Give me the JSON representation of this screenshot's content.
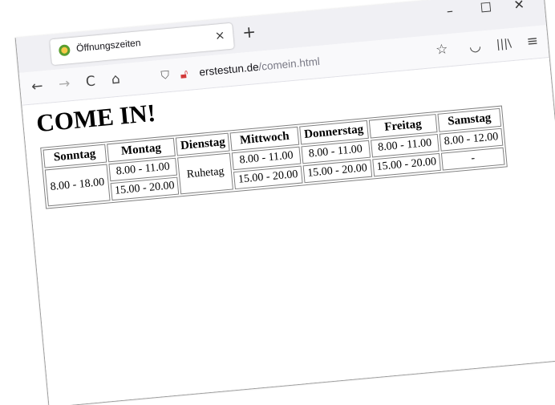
{
  "browser": {
    "tab_title": "Öffnungszeiten",
    "tab_close": "×",
    "new_tab": "+",
    "minimize": "–",
    "maximize": "☐",
    "close": "✕",
    "url_host": "erstestun.de",
    "url_path": "/comein.html",
    "nav": {
      "back": "←",
      "forward": "→",
      "reload": "C",
      "home": "⌂"
    },
    "toolbar": {
      "bookmark": "☆",
      "pocket": "◡",
      "library": "|||\\",
      "menu": "≡"
    },
    "icons": {
      "favicon": "favicon-icon",
      "shield": "shield-icon",
      "lock": "insecure-lock-icon"
    }
  },
  "page": {
    "heading": "COME IN!",
    "days": [
      "Sonntag",
      "Montag",
      "Dienstag",
      "Mittwoch",
      "Donnerstag",
      "Freitag",
      "Samstag"
    ],
    "hours": {
      "sonntag": "8.00 - 18.00",
      "montag_1": "8.00 - 11.00",
      "montag_2": "15.00 - 20.00",
      "dienstag": "Ruhetag",
      "mittwoch_1": "8.00 - 11.00",
      "mittwoch_2": "15.00 - 20.00",
      "donnerstag_1": "8.00 - 11.00",
      "donnerstag_2": "15.00 - 20.00",
      "freitag_1": "8.00 - 11.00",
      "freitag_2": "15.00 - 20.00",
      "samstag_1": "8.00 - 12.00",
      "samstag_2": "-"
    }
  }
}
